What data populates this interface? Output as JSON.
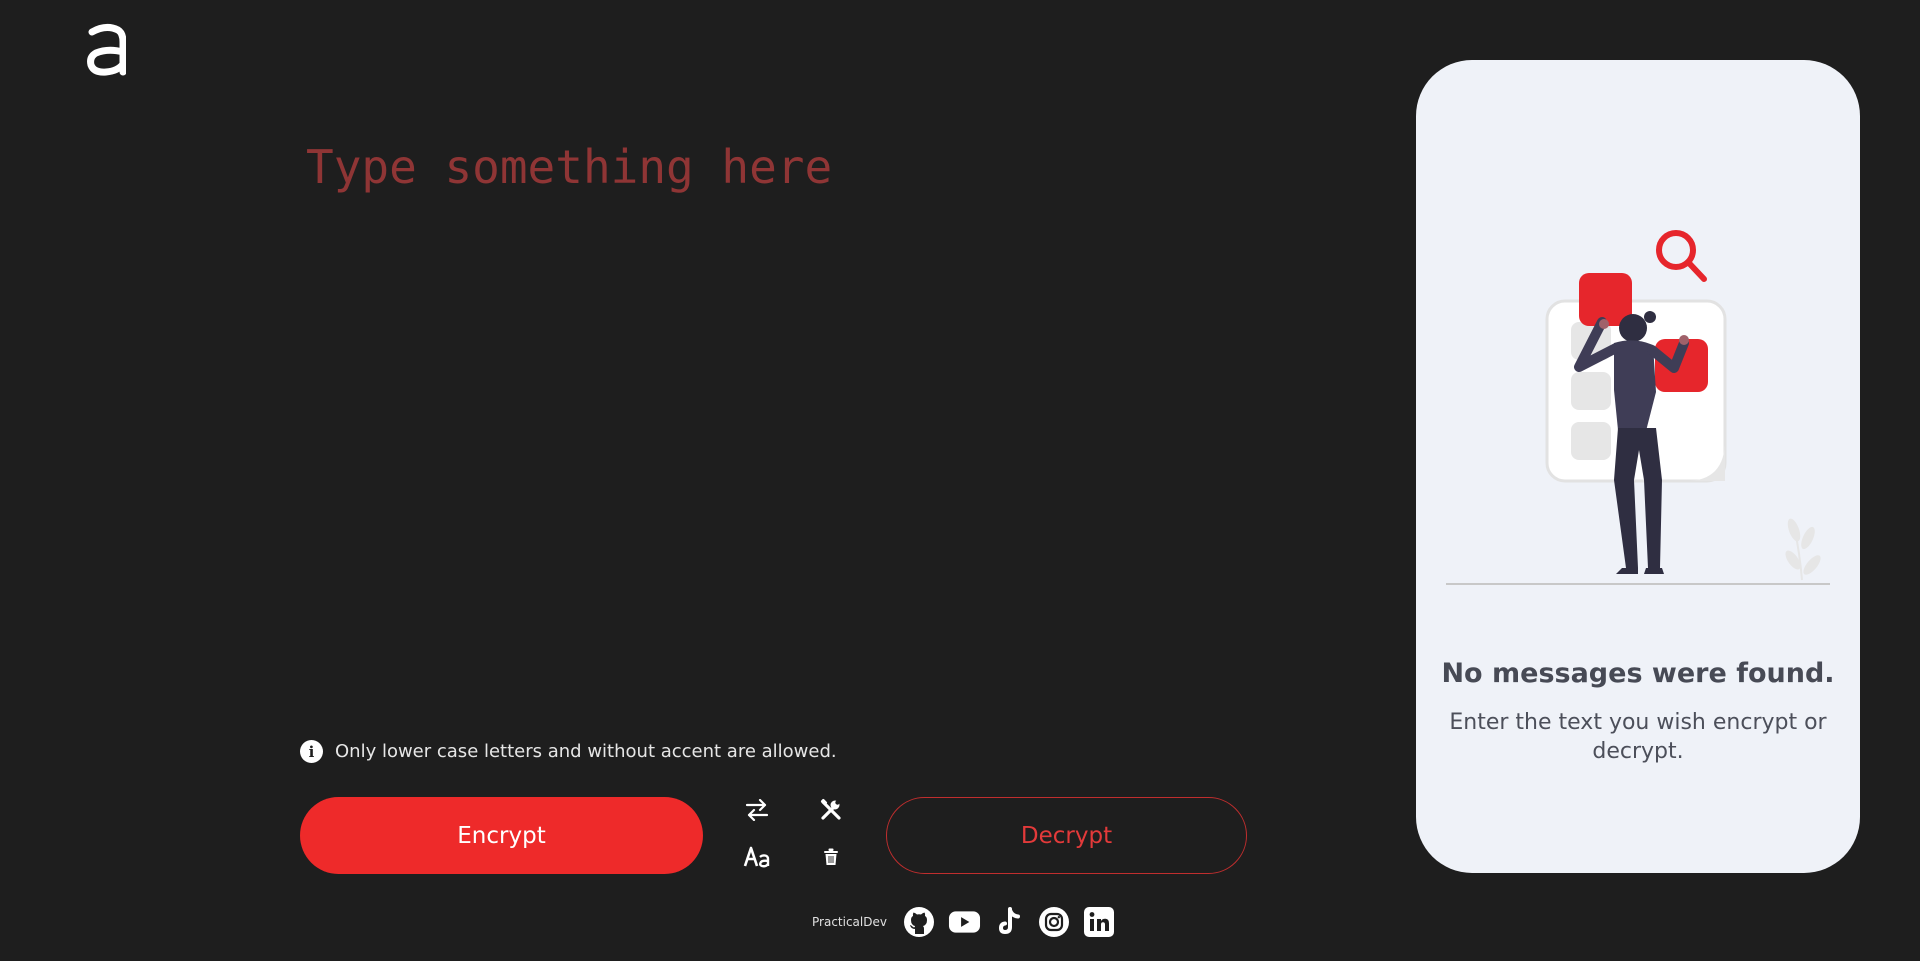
{
  "brand": {
    "logo_letter": "a",
    "footer_name": "PracticalDev"
  },
  "editor": {
    "placeholder": "Type something here"
  },
  "notice": {
    "icon": "info-icon",
    "text": "Only lower case letters and without accent are allowed."
  },
  "actions": {
    "encrypt_label": "Encrypt",
    "decrypt_label": "Decrypt",
    "tools": [
      "swap-icon",
      "wrench-icon",
      "font-case-icon",
      "trash-icon"
    ]
  },
  "social": [
    "github-icon",
    "youtube-icon",
    "tiktok-icon",
    "instagram-icon",
    "linkedin-icon"
  ],
  "result_panel": {
    "title": "No messages were found.",
    "message": "Enter the text you wish encrypt or decrypt."
  },
  "colors": {
    "background": "#1e1e1e",
    "accent": "#ee2a2a",
    "placeholder": "#8f3535",
    "panel": "#eff2f8"
  }
}
